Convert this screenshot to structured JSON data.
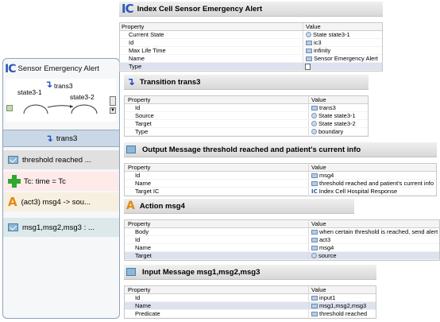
{
  "left_panel": {
    "title": "Sensor Emergency Alert",
    "diagram": {
      "transition_label": "trans3",
      "state_a": "state3-1",
      "state_b": "state3-2"
    },
    "section_label": "trans3",
    "rows": [
      {
        "label": "threshold reached ...",
        "icon": "message-icon"
      },
      {
        "label": "Tc: time = Tc",
        "icon": "plus-icon"
      },
      {
        "label": "(act3) msg4 -> sou...",
        "icon": "action-icon"
      },
      {
        "label": "msg1,msg2,msg3 : ...",
        "icon": "message-icon"
      }
    ]
  },
  "sheets": {
    "cell": {
      "title": "Index Cell Sensor Emergency Alert",
      "col_property": "Property",
      "col_value": "Value",
      "rows": [
        {
          "property": "Current State",
          "value": "State state3-1",
          "icon": "circ"
        },
        {
          "property": "Id",
          "value": "ic3",
          "icon": "doc"
        },
        {
          "property": "Max Life Time",
          "value": "infinity",
          "icon": "doc"
        },
        {
          "property": "Name",
          "value": "Sensor Emergency Alert",
          "icon": "doc"
        },
        {
          "property": "Type",
          "value": "",
          "icon": "none"
        }
      ]
    },
    "transition": {
      "title": "Transition trans3",
      "col_property": "Property",
      "col_value": "Value",
      "rows": [
        {
          "property": "Id",
          "value": "trans3",
          "icon": "doc"
        },
        {
          "property": "Source",
          "value": "State state3-1",
          "icon": "circ"
        },
        {
          "property": "Target",
          "value": "State state3-2",
          "icon": "circ"
        },
        {
          "property": "Type",
          "value": "boundary",
          "icon": "circ"
        }
      ]
    },
    "output": {
      "title": "Output Message threshold reached and patient's current info",
      "col_property": "Property",
      "col_value": "Value",
      "rows": [
        {
          "property": "Id",
          "value": "msg4",
          "icon": "doc"
        },
        {
          "property": "Name",
          "value": "threshold reached and patient's current info",
          "icon": "doc"
        },
        {
          "property": "Target IC",
          "value": "Index Cell Hospital Response",
          "icon": "ic"
        }
      ]
    },
    "action": {
      "title": "Action msg4",
      "col_property": "Property",
      "col_value": "Value",
      "rows": [
        {
          "property": "Body",
          "value": "when certain threshold is reached, send alert",
          "icon": "doc"
        },
        {
          "property": "Id",
          "value": "act3",
          "icon": "doc"
        },
        {
          "property": "Name",
          "value": "msg4",
          "icon": "doc"
        },
        {
          "property": "Target",
          "value": "source",
          "icon": "circ"
        }
      ]
    },
    "input": {
      "title": "Input Message msg1,msg2,msg3",
      "col_property": "Property",
      "col_value": "Value",
      "rows": [
        {
          "property": "Id",
          "value": "input1",
          "icon": "doc"
        },
        {
          "property": "Name",
          "value": "msg1,msg2,msg3",
          "icon": "doc"
        },
        {
          "property": "Predicate",
          "value": "threshold reached",
          "icon": "doc"
        }
      ]
    }
  },
  "colors": {
    "ic_blue": "#2d58b4",
    "transition_blue": "#1e50c4",
    "action_orange": "#e38a12",
    "plus_green": "#2fa82f"
  }
}
